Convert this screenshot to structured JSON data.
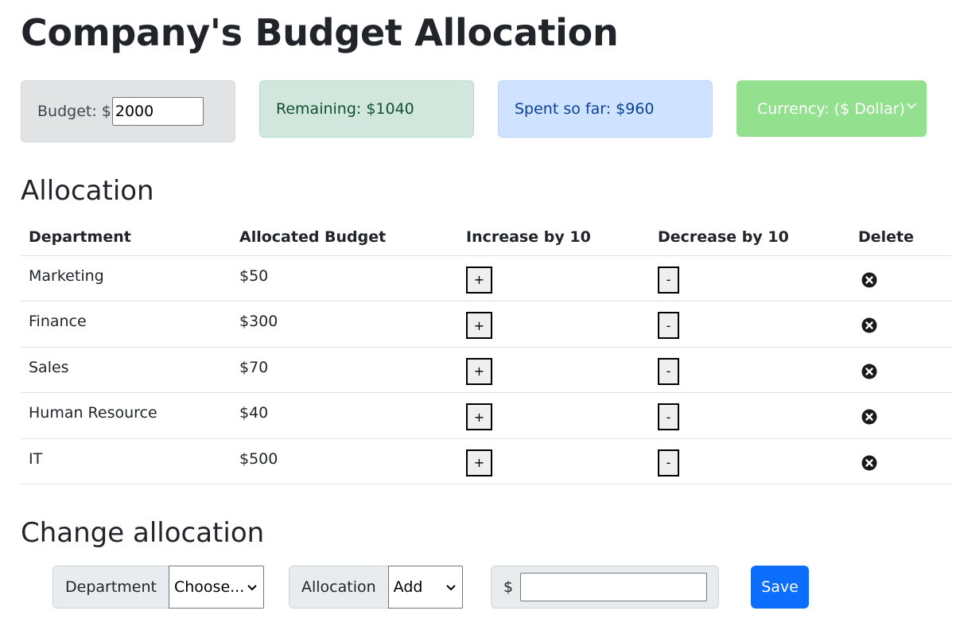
{
  "page_title": "Company's Budget Allocation",
  "summary": {
    "budget_label": "Budget: $",
    "budget_value": "2000",
    "remaining": "Remaining: $1040",
    "spent": "Spent so far: $960",
    "currency": "Currency: ($ Dollar)"
  },
  "allocation": {
    "heading": "Allocation",
    "columns": [
      "Department",
      "Allocated Budget",
      "Increase by 10",
      "Decrease by 10",
      "Delete"
    ],
    "rows": [
      {
        "department": "Marketing",
        "budget": "$50"
      },
      {
        "department": "Finance",
        "budget": "$300"
      },
      {
        "department": "Sales",
        "budget": "$70"
      },
      {
        "department": "Human Resource",
        "budget": "$40"
      },
      {
        "department": "IT",
        "budget": "$500"
      }
    ],
    "increase_label": "+",
    "decrease_label": "-"
  },
  "change": {
    "heading": "Change allocation",
    "department_label": "Department",
    "department_selected": "Choose...",
    "allocation_label": "Allocation",
    "allocation_selected": "Add",
    "currency_prefix": "$",
    "amount_value": "",
    "save_label": "Save"
  },
  "colors": {
    "primary": "#0d6efd",
    "currency_card": "#93e08f",
    "remaining_card": "#d1e7dd",
    "spent_card": "#cfe2ff",
    "budget_card": "#e2e3e5"
  },
  "icons": {
    "delete": "circle-x-icon",
    "dropdown": "chevron-down-icon"
  }
}
